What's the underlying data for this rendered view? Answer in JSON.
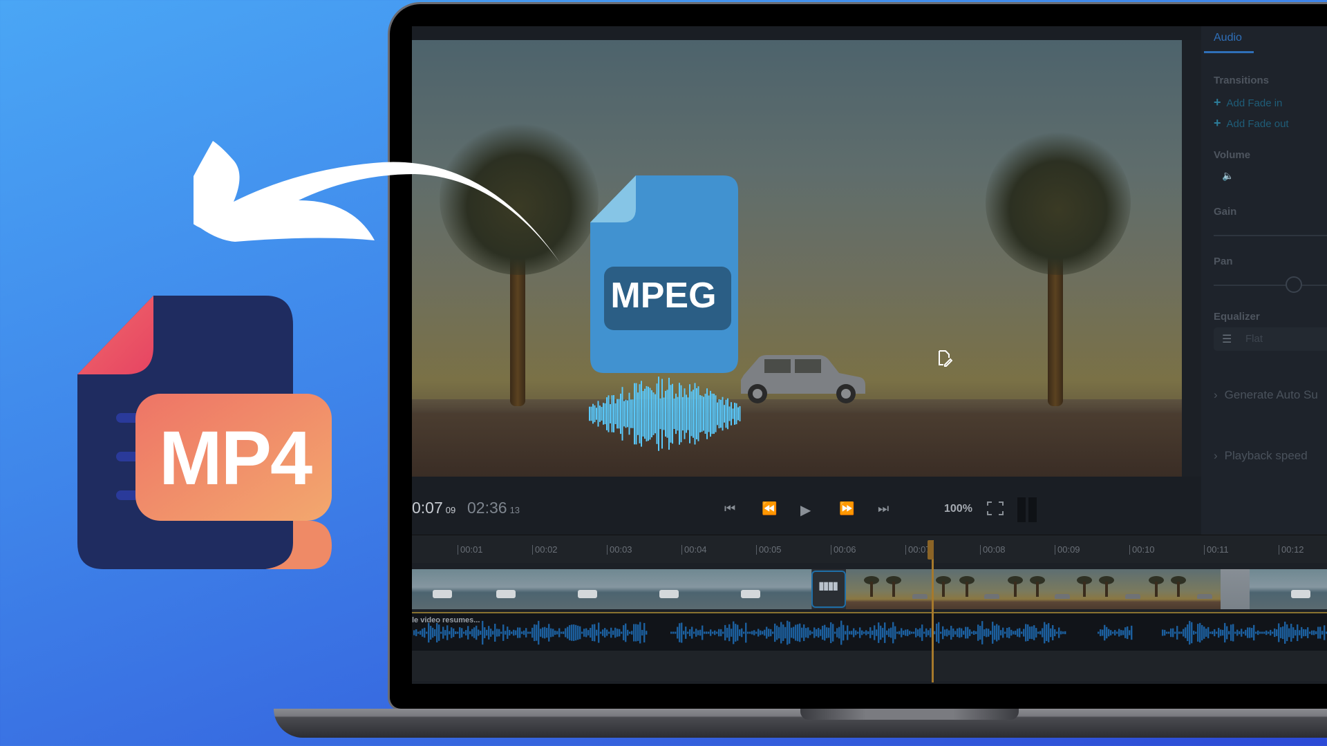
{
  "overlay": {
    "target_format": "MP4",
    "source_format": "MPEG",
    "arrow_direction": "left",
    "colors": {
      "background_top": "#4aa6f5",
      "background_bottom": "#2c4ad6",
      "mp4_doc": "#1f2c5e",
      "mp4_label_bg": "#f0836a",
      "mp4_corner": "#e84a63",
      "mpeg_doc": "#4192d0",
      "mpeg_label_bg": "#2b5e85",
      "mpeg_wave": "#5ac8fa"
    }
  },
  "editor": {
    "side_panel": {
      "active_tab": "Audio",
      "transitions_label": "Transitions",
      "add_fade_in": "Add Fade in",
      "add_fade_out": "Add Fade out",
      "volume_label": "Volume",
      "gain_label": "Gain",
      "pan_label": "Pan",
      "equalizer_label": "Equalizer",
      "equalizer_value": "Flat",
      "generate_subtitles": "Generate Auto Su",
      "playback_speed": "Playback speed"
    },
    "player": {
      "current_time": "0:07",
      "current_frame": "09",
      "total_time": "02:36",
      "total_frame": "13",
      "zoom": "100%"
    },
    "timeline": {
      "ticks": [
        "00:01",
        "00:02",
        "00:03",
        "00:04",
        "00:05",
        "00:06",
        "00:07",
        "00:08",
        "00:09",
        "00:10",
        "00:11",
        "00:12"
      ],
      "audio_clip_label": "le video resumes...",
      "playhead_time": "00:07",
      "accent": "#a6792c",
      "waveform_color": "#1c5f9e"
    }
  }
}
